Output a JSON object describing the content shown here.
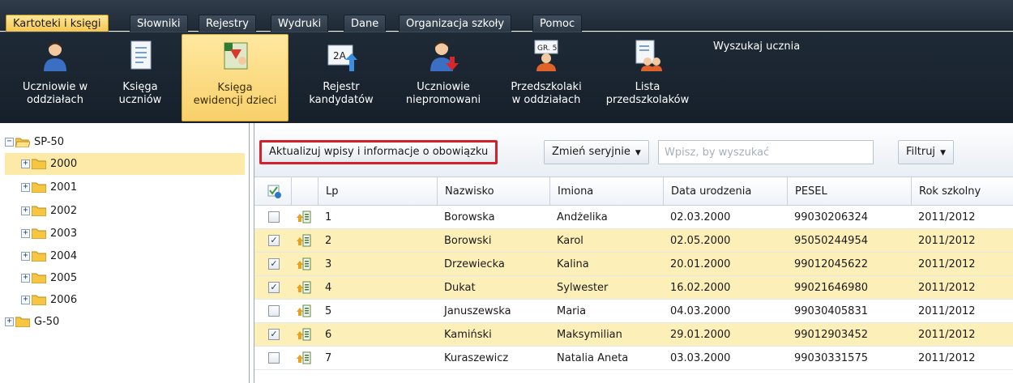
{
  "menu": {
    "tabs": [
      {
        "label": "Kartoteki i księgi",
        "active": true
      },
      {
        "label": "Słowniki",
        "active": false
      },
      {
        "label": "Rejestry",
        "active": false
      },
      {
        "label": "Wydruki",
        "active": false
      },
      {
        "label": "Dane",
        "active": false
      },
      {
        "label": "Organizacja szkoły",
        "active": false
      },
      {
        "label": "Pomoc",
        "active": false
      }
    ]
  },
  "ribbon": {
    "buttons": [
      {
        "label": "Uczniowie w\noddziałach",
        "icon": "student-icon",
        "active": false
      },
      {
        "label": "Księga\nuczniów",
        "icon": "book-icon",
        "active": false
      },
      {
        "label": "Księga\newidencji dzieci",
        "icon": "children-register-icon",
        "active": true
      },
      {
        "label": "Rejestr\nkandydatów",
        "icon": "candidates-register-icon",
        "active": false
      },
      {
        "label": "Uczniowie\nniepromowani",
        "icon": "not-promoted-icon",
        "active": false
      },
      {
        "label": "Przedszkolaki\nw oddziałach",
        "icon": "preschool-class-icon",
        "active": false
      },
      {
        "label": "Lista\nprzedszkolaków",
        "icon": "preschool-list-icon",
        "active": false
      }
    ],
    "search_label": "Wyszukaj ucznia"
  },
  "tree": {
    "root": "SP-50",
    "children": [
      "2000",
      "2001",
      "2002",
      "2003",
      "2004",
      "2005",
      "2006"
    ],
    "selected": "2000",
    "other_root": "G-50"
  },
  "toolbar": {
    "update_button": "Aktualizuj wpisy i informacje o obowiązku",
    "change_button": "Zmień seryjnie",
    "search_placeholder": "Wpisz, by wyszukać",
    "filter_button": "Filtruj"
  },
  "grid": {
    "columns": [
      "Lp",
      "Nazwisko",
      "Imiona",
      "Data urodzenia",
      "PESEL",
      "Rok szkolny"
    ],
    "rows": [
      {
        "checked": false,
        "lp": "1",
        "nazwisko": "Borowska",
        "imiona": "Andżelika",
        "data": "02.03.2000",
        "pesel": "99030206324",
        "rok": "2011/2012"
      },
      {
        "checked": true,
        "lp": "2",
        "nazwisko": "Borowski",
        "imiona": "Karol",
        "data": "02.05.2000",
        "pesel": "95050244954",
        "rok": "2011/2012"
      },
      {
        "checked": true,
        "lp": "3",
        "nazwisko": "Drzewiecka",
        "imiona": "Kalina",
        "data": "20.01.2000",
        "pesel": "99012045622",
        "rok": "2011/2012"
      },
      {
        "checked": true,
        "lp": "4",
        "nazwisko": "Dukat",
        "imiona": "Sylwester",
        "data": "16.02.2000",
        "pesel": "99021646980",
        "rok": "2011/2012"
      },
      {
        "checked": false,
        "lp": "5",
        "nazwisko": "Januszewska",
        "imiona": "Maria",
        "data": "04.03.2000",
        "pesel": "99030405831",
        "rok": "2011/2012"
      },
      {
        "checked": true,
        "lp": "6",
        "nazwisko": "Kamiński",
        "imiona": "Maksymilian",
        "data": "29.01.2000",
        "pesel": "99012903452",
        "rok": "2011/2012"
      },
      {
        "checked": false,
        "lp": "7",
        "nazwisko": "Kuraszewicz",
        "imiona": "Natalia Aneta",
        "data": "03.03.2000",
        "pesel": "99030331575",
        "rok": "2011/2012"
      }
    ]
  },
  "colors": {
    "menubar": "#1f2a36",
    "active_tab": "#f6c64a",
    "selected_row": "#fdefb8",
    "highlight_border": "#d4202a"
  }
}
